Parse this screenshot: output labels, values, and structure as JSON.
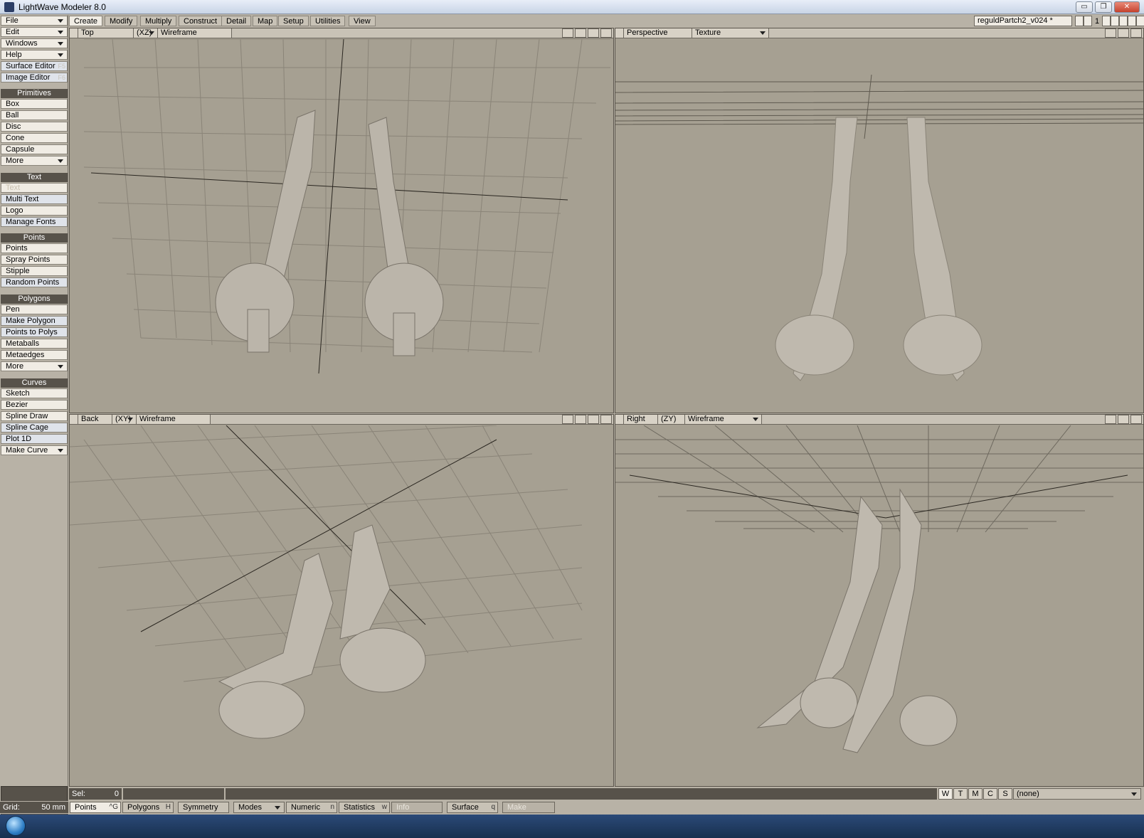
{
  "window": {
    "title": "LightWave Modeler 8.0",
    "min": "▭",
    "max": "❐",
    "close": "✕"
  },
  "left_panel": {
    "top_menu": [
      {
        "label": "File",
        "dropdown": true
      },
      {
        "label": "Edit",
        "dropdown": true
      },
      {
        "label": "Windows",
        "dropdown": true
      },
      {
        "label": "Help",
        "dropdown": true
      },
      {
        "label": "Surface Editor",
        "key": "F5"
      },
      {
        "label": "Image Editor",
        "key": "F6"
      }
    ],
    "sections": [
      {
        "title": "Primitives",
        "items": [
          "Box",
          "Ball",
          "Disc",
          "Cone",
          "Capsule",
          "More"
        ]
      },
      {
        "title": "Text",
        "items": [
          "Text",
          "Multi Text",
          "Logo",
          "Manage Fonts"
        ]
      },
      {
        "title": "Points",
        "items": [
          "Points",
          "Spray Points",
          "Stipple",
          "Random Points"
        ]
      },
      {
        "title": "Polygons",
        "items": [
          "Pen",
          "Make Polygon",
          "Points to Polys",
          "Metaballs",
          "Metaedges",
          "More"
        ]
      },
      {
        "title": "Curves",
        "items": [
          "Sketch",
          "Bezier",
          "Spline Draw",
          "Spline Cage",
          "Plot 1D",
          "Make Curve"
        ]
      }
    ]
  },
  "tabs": [
    "Create",
    "Modify",
    "Multiply",
    "Construct",
    "Detail",
    "Map",
    "Setup",
    "Utilities",
    "View"
  ],
  "active_tab": "Create",
  "object_name": "reguldPartch2_v024 *",
  "layer_label": "1",
  "viewports": [
    {
      "view": "Top",
      "axis": "(XZ)",
      "mode": "Wireframe"
    },
    {
      "view": "Perspective",
      "axis": "",
      "mode": "Texture"
    },
    {
      "view": "Back",
      "axis": "(XY)",
      "mode": "Wireframe"
    },
    {
      "view": "Right",
      "axis": "(ZY)",
      "mode": "Wireframe"
    }
  ],
  "status": {
    "sel_label": "Sel:",
    "sel_value": "0",
    "toggles": [
      "W",
      "T",
      "M",
      "C",
      "S"
    ],
    "surface": "(none)"
  },
  "bottom": {
    "grid_label": "Grid:",
    "grid_value": "50 mm",
    "buttons": [
      {
        "label": "Points",
        "key": "^G"
      },
      {
        "label": "Polygons",
        "key": "H"
      },
      {
        "label": "Symmetry",
        "key": ""
      },
      {
        "label": "Modes",
        "key": ""
      },
      {
        "label": "Numeric",
        "key": "n"
      },
      {
        "label": "Statistics",
        "key": "w"
      },
      {
        "label": "Info",
        "key": ""
      },
      {
        "label": "Surface",
        "key": "q"
      },
      {
        "label": "Make",
        "key": ""
      }
    ]
  },
  "colors": {
    "panel": "#b8b2a6",
    "viewport_bg": "#a6a092",
    "section_header": "#57524a",
    "model": "#b8b2a8"
  }
}
